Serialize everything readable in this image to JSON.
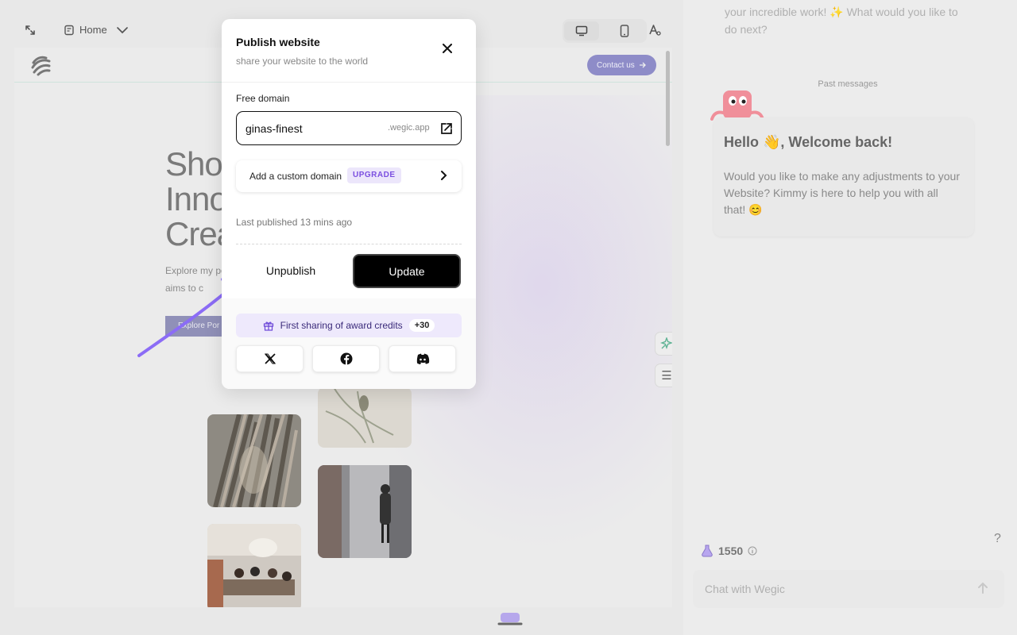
{
  "toolbar": {
    "page_select_label": "Home",
    "icons": [
      "collapse-icon",
      "page-icon",
      "chevron-down-icon",
      "desktop-icon",
      "mobile-icon",
      "font-style-icon"
    ]
  },
  "site_preview": {
    "contact_button": "Contact us",
    "hero_title_lines": [
      "Sho",
      "Inno",
      "Crea"
    ],
    "hero_sub_lines": [
      "Explore my po",
      "aims to c"
    ],
    "hero_button": "Explore Por"
  },
  "modal": {
    "title": "Publish website",
    "subtitle": "share your website to the world",
    "free_domain_label": "Free domain",
    "domain_value": "ginas-finest",
    "domain_suffix": ".wegic.app",
    "custom_domain_label": "Add a custom domain",
    "upgrade_badge": "UPGRADE",
    "last_published": "Last published 13 mins ago",
    "unpublish_button": "Unpublish",
    "update_button": "Update",
    "award_text": "First sharing of award credits",
    "award_badge": "+30",
    "social_buttons": [
      "x-icon",
      "facebook-icon",
      "discord-icon"
    ]
  },
  "chat": {
    "previous_message_tail": "your incredible work! ✨ What would you like to do next?",
    "past_messages_label": "Past messages",
    "greeting": "Hello 👋, Welcome back!",
    "message": "Would you like to make any adjustments to your Website? Kimmy is here to help you with all that! 😊",
    "credits": "1550",
    "input_placeholder": "Chat with Wegic",
    "help_label": "?"
  },
  "colors": {
    "accent_purple": "#7b4fe0",
    "arrow_purple": "#8b6cf6",
    "update_bg": "#000000",
    "upgrade_bg": "#ece6fb",
    "award_bg": "#eee9fc"
  }
}
